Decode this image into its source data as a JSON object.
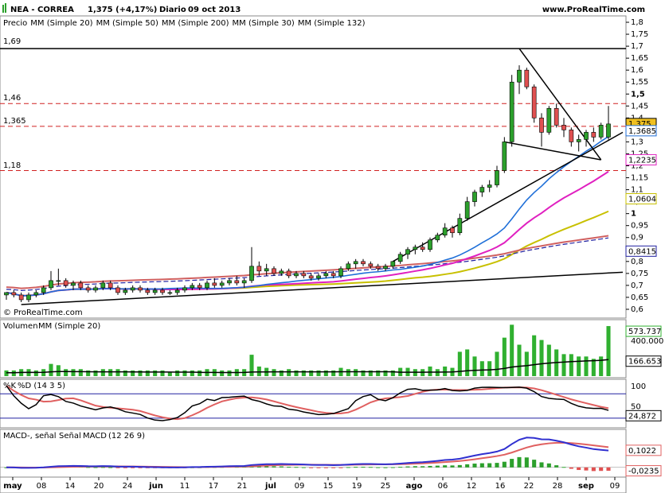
{
  "header": {
    "symbol": "NEA - CORREA",
    "price_change": "1,375 (+4,17%)",
    "period": "Diario",
    "date": "09 oct 2013",
    "site": "www.ProRealTime.com",
    "copyright": "© ProRealTime.com"
  },
  "colors": {
    "up": "#2ca02c",
    "down": "#e05050",
    "sma20": "#1f6fd8",
    "sma50": "#c8c000",
    "sma200": "#d06060",
    "sma30": "#e020c0",
    "sma132": "#2020a0",
    "macd": "#3030d0",
    "signal": "#e06060",
    "support": "#d02020",
    "volume": "#30b030"
  },
  "price_panel": {
    "legend": [
      {
        "text": "Precio",
        "color": "#000000"
      },
      {
        "text": "MM (Simple 20)",
        "color": "#1f6fd8"
      },
      {
        "text": "MM (Simple 50)",
        "color": "#c8c000"
      },
      {
        "text": "MM (Simple 200)",
        "color": "#d06060"
      },
      {
        "text": "MM (Simple 30)",
        "color": "#e020c0"
      },
      {
        "text": "MM (Simple 132)",
        "color": "#2020a0"
      }
    ],
    "levels": [
      "1,69",
      "1,46",
      "1,365",
      "1,18"
    ],
    "ticks": [
      "1,8",
      "1,75",
      "1,7",
      "1,65",
      "1,6",
      "1,55",
      "1,5",
      "1,45",
      "1,4",
      "1,35",
      "1,3",
      "1,25",
      "1,2",
      "1,15",
      "1,1",
      "1,05",
      "1",
      "0,95",
      "0,9",
      "0,85",
      "0,8",
      "0,75",
      "0,7",
      "0,65",
      "0,6"
    ],
    "value_tags": [
      {
        "text": "1,375",
        "value": 1.375,
        "bg": "#f0c020",
        "fg": "#000000"
      },
      {
        "text": "1,3685",
        "value": 1.345,
        "bg": "#ffffff",
        "fg": "#1f6fd8"
      },
      {
        "text": "1,2235",
        "value": 1.2235,
        "bg": "#ffffff",
        "fg": "#e020c0"
      },
      {
        "text": "1,0604",
        "value": 1.0604,
        "bg": "#ffffff",
        "fg": "#c8c000"
      },
      {
        "text": "0,8415",
        "value": 0.8415,
        "bg": "#ffffff",
        "fg": "#2020a0"
      }
    ]
  },
  "volume_panel": {
    "legend": [
      {
        "text": "Volumen",
        "color": "#30b030"
      },
      {
        "text": "MM (Simple 20)",
        "color": "#000000"
      }
    ],
    "ticks": [
      "400.000"
    ],
    "value_tags": [
      {
        "text": "573.737",
        "bg": "#ffffff",
        "fg": "#30b030"
      },
      {
        "text": "166.653",
        "bg": "#ffffff",
        "fg": "#000000"
      }
    ]
  },
  "stoch_panel": {
    "legend": [
      {
        "text": "%K",
        "color": "#000000"
      },
      {
        "text": "%D (14 3 5)",
        "color": "#e06060"
      }
    ],
    "ticks": [
      "100",
      "50"
    ],
    "value_tags": [
      {
        "text": "24,872",
        "bg": "#ffffff",
        "fg": "#000000"
      }
    ]
  },
  "macd_panel": {
    "legend": [
      {
        "text": "MACD-, señal",
        "color": "#e06060"
      },
      {
        "text": "Señal",
        "color": "#e06060"
      },
      {
        "text": "MACD",
        "color": "#3030d0"
      },
      {
        "text": "(12 26 9)",
        "color": "#3030d0"
      }
    ],
    "value_tags": [
      {
        "text": "0,1022",
        "bg": "#ffffff",
        "fg": "#e06060"
      },
      {
        "text": "-0,0235",
        "bg": "#ffffff",
        "fg": "#e06060"
      }
    ]
  },
  "x_axis": [
    "may",
    "08",
    "14",
    "20",
    "24",
    "jun",
    "11",
    "17",
    "21",
    "jul",
    "09",
    "15",
    "19",
    "25",
    "ago",
    "06",
    "12",
    "16",
    "22",
    "28",
    "sep",
    "09"
  ],
  "chart_data": {
    "type": "candlestick",
    "title": "NEA - CORREA",
    "ylim": [
      0.57,
      1.82
    ],
    "candles": [
      [
        0.66,
        0.67,
        0.64,
        0.67
      ],
      [
        0.67,
        0.68,
        0.65,
        0.66
      ],
      [
        0.66,
        0.67,
        0.63,
        0.64
      ],
      [
        0.64,
        0.67,
        0.63,
        0.66
      ],
      [
        0.66,
        0.68,
        0.65,
        0.67
      ],
      [
        0.67,
        0.7,
        0.66,
        0.69
      ],
      [
        0.69,
        0.76,
        0.68,
        0.72
      ],
      [
        0.72,
        0.77,
        0.7,
        0.72
      ],
      [
        0.72,
        0.73,
        0.69,
        0.7
      ],
      [
        0.7,
        0.72,
        0.68,
        0.71
      ],
      [
        0.71,
        0.72,
        0.68,
        0.69
      ],
      [
        0.69,
        0.7,
        0.67,
        0.68
      ],
      [
        0.68,
        0.7,
        0.67,
        0.69
      ],
      [
        0.69,
        0.72,
        0.68,
        0.71
      ],
      [
        0.71,
        0.72,
        0.68,
        0.69
      ],
      [
        0.69,
        0.7,
        0.66,
        0.67
      ],
      [
        0.67,
        0.69,
        0.66,
        0.68
      ],
      [
        0.68,
        0.7,
        0.67,
        0.69
      ],
      [
        0.69,
        0.7,
        0.67,
        0.68
      ],
      [
        0.68,
        0.69,
        0.66,
        0.67
      ],
      [
        0.67,
        0.69,
        0.66,
        0.68
      ],
      [
        0.68,
        0.69,
        0.66,
        0.67
      ],
      [
        0.67,
        0.68,
        0.66,
        0.67
      ],
      [
        0.67,
        0.69,
        0.66,
        0.68
      ],
      [
        0.68,
        0.7,
        0.67,
        0.69
      ],
      [
        0.69,
        0.71,
        0.68,
        0.7
      ],
      [
        0.7,
        0.71,
        0.68,
        0.69
      ],
      [
        0.69,
        0.72,
        0.68,
        0.71
      ],
      [
        0.71,
        0.73,
        0.69,
        0.7
      ],
      [
        0.7,
        0.72,
        0.69,
        0.71
      ],
      [
        0.71,
        0.73,
        0.7,
        0.72
      ],
      [
        0.72,
        0.74,
        0.7,
        0.71
      ],
      [
        0.71,
        0.73,
        0.69,
        0.72
      ],
      [
        0.72,
        0.86,
        0.71,
        0.78
      ],
      [
        0.78,
        0.8,
        0.74,
        0.76
      ],
      [
        0.76,
        0.79,
        0.74,
        0.77
      ],
      [
        0.77,
        0.78,
        0.74,
        0.75
      ],
      [
        0.75,
        0.77,
        0.74,
        0.76
      ],
      [
        0.76,
        0.77,
        0.73,
        0.74
      ],
      [
        0.74,
        0.76,
        0.73,
        0.75
      ],
      [
        0.75,
        0.76,
        0.73,
        0.74
      ],
      [
        0.74,
        0.75,
        0.72,
        0.73
      ],
      [
        0.73,
        0.75,
        0.72,
        0.74
      ],
      [
        0.74,
        0.76,
        0.73,
        0.75
      ],
      [
        0.75,
        0.76,
        0.73,
        0.74
      ],
      [
        0.74,
        0.78,
        0.73,
        0.77
      ],
      [
        0.77,
        0.8,
        0.76,
        0.79
      ],
      [
        0.79,
        0.81,
        0.77,
        0.8
      ],
      [
        0.8,
        0.81,
        0.78,
        0.79
      ],
      [
        0.79,
        0.8,
        0.77,
        0.78
      ],
      [
        0.78,
        0.79,
        0.76,
        0.77
      ],
      [
        0.77,
        0.79,
        0.76,
        0.78
      ],
      [
        0.78,
        0.8,
        0.77,
        0.8
      ],
      [
        0.8,
        0.84,
        0.79,
        0.83
      ],
      [
        0.83,
        0.86,
        0.81,
        0.85
      ],
      [
        0.85,
        0.87,
        0.83,
        0.86
      ],
      [
        0.86,
        0.88,
        0.84,
        0.85
      ],
      [
        0.85,
        0.9,
        0.84,
        0.89
      ],
      [
        0.89,
        0.92,
        0.88,
        0.91
      ],
      [
        0.91,
        0.96,
        0.9,
        0.94
      ],
      [
        0.94,
        0.95,
        0.9,
        0.92
      ],
      [
        0.92,
        1.0,
        0.91,
        0.98
      ],
      [
        0.98,
        1.07,
        0.97,
        1.05
      ],
      [
        1.05,
        1.1,
        1.03,
        1.09
      ],
      [
        1.09,
        1.12,
        1.07,
        1.11
      ],
      [
        1.11,
        1.14,
        1.09,
        1.12
      ],
      [
        1.12,
        1.2,
        1.11,
        1.18
      ],
      [
        1.18,
        1.32,
        1.17,
        1.3
      ],
      [
        1.3,
        1.58,
        1.28,
        1.55
      ],
      [
        1.55,
        1.62,
        1.5,
        1.6
      ],
      [
        1.6,
        1.61,
        1.52,
        1.53
      ],
      [
        1.53,
        1.54,
        1.38,
        1.4
      ],
      [
        1.4,
        1.42,
        1.28,
        1.34
      ],
      [
        1.34,
        1.45,
        1.33,
        1.44
      ],
      [
        1.44,
        1.46,
        1.36,
        1.37
      ],
      [
        1.37,
        1.4,
        1.32,
        1.35
      ],
      [
        1.35,
        1.36,
        1.28,
        1.3
      ],
      [
        1.3,
        1.33,
        1.26,
        1.31
      ],
      [
        1.31,
        1.35,
        1.28,
        1.34
      ],
      [
        1.34,
        1.36,
        1.3,
        1.32
      ],
      [
        1.32,
        1.38,
        1.31,
        1.37
      ],
      [
        1.32,
        1.45,
        1.31,
        1.375
      ]
    ],
    "support_levels": [
      1.69,
      1.46,
      1.365,
      1.18
    ],
    "volume_ylim": [
      0,
      620000
    ],
    "stoch_ylim": [
      0,
      110
    ],
    "macd_ylim": [
      -0.05,
      0.16
    ]
  }
}
